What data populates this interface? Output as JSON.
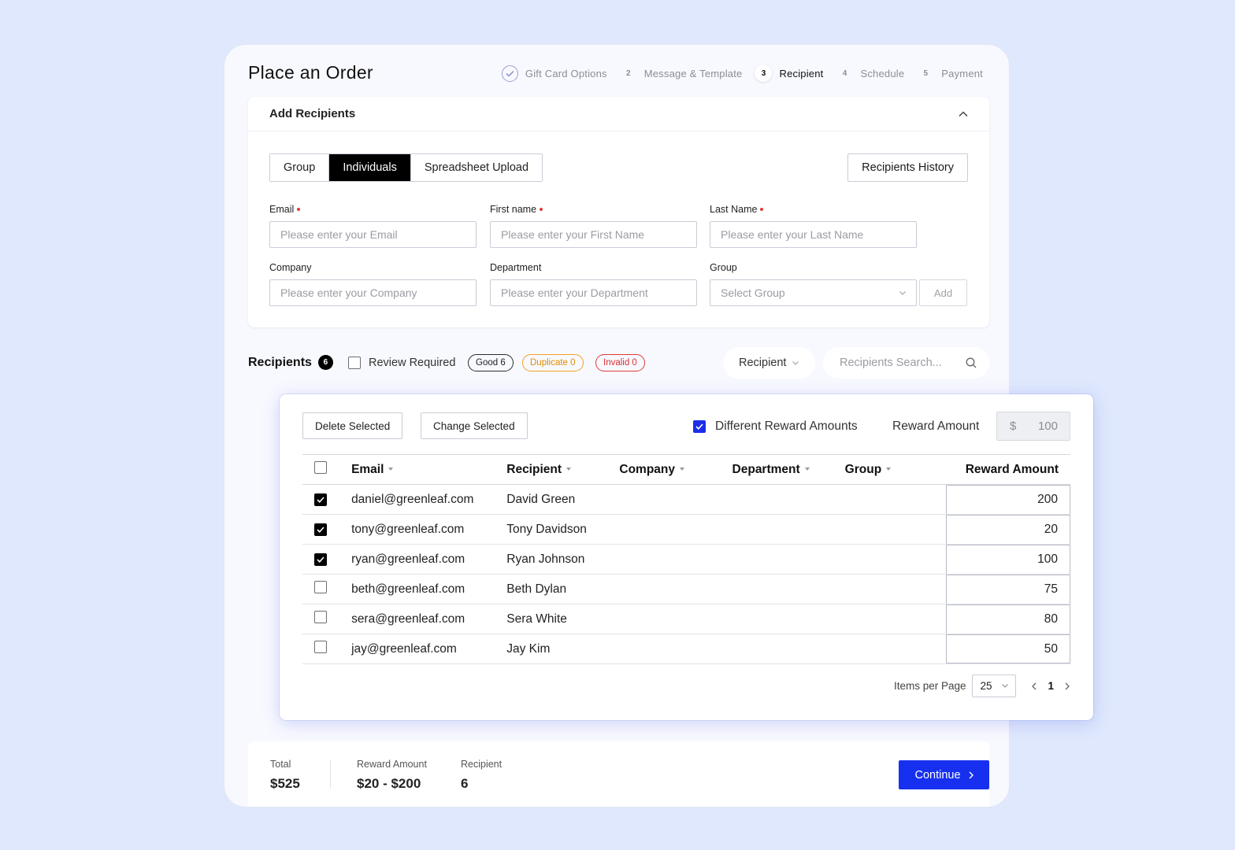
{
  "header": {
    "title": "Place an Order",
    "steps": [
      {
        "num": "",
        "label": "Gift Card Options",
        "state": "done"
      },
      {
        "num": "2",
        "label": "Message & Template",
        "state": "todo"
      },
      {
        "num": "3",
        "label": "Recipient",
        "state": "active"
      },
      {
        "num": "4",
        "label": "Schedule",
        "state": "todo"
      },
      {
        "num": "5",
        "label": "Payment",
        "state": "todo"
      }
    ]
  },
  "add_panel": {
    "title": "Add Recipients",
    "tabs": [
      "Group",
      "Individuals",
      "Spreadsheet Upload"
    ],
    "active_tab": "Individuals",
    "history_label": "Recipients History",
    "fields": {
      "email": {
        "label": "Email",
        "placeholder": "Please enter your Email"
      },
      "first_name": {
        "label": "First name",
        "placeholder": "Please enter your First Name"
      },
      "last_name": {
        "label": "Last Name",
        "placeholder": "Please enter your Last Name"
      },
      "company": {
        "label": "Company",
        "placeholder": "Please enter your Company"
      },
      "department": {
        "label": "Department",
        "placeholder": "Please enter your Department"
      },
      "group": {
        "label": "Group",
        "placeholder": "Select Group"
      }
    },
    "add_label": "Add"
  },
  "recipients_bar": {
    "title": "Recipients",
    "count": "6",
    "review_label": "Review Required",
    "good": "Good 6",
    "duplicate": "Duplicate 0",
    "invalid": "Invalid 0",
    "filter_label": "Recipient",
    "search_placeholder": "Recipients Search..."
  },
  "table_panel": {
    "delete_label": "Delete Selected",
    "change_label": "Change Selected",
    "different_label": "Different Reward Amounts",
    "reward_label": "Reward Amount",
    "currency": "$",
    "reward_value": "100",
    "columns": [
      "Email",
      "Recipient",
      "Company",
      "Department",
      "Group",
      "Reward Amount"
    ],
    "rows": [
      {
        "email": "daniel@greenleaf.com",
        "recipient": "David Green",
        "company": "",
        "department": "",
        "group": "",
        "amount": "200",
        "checked": true
      },
      {
        "email": "tony@greenleaf.com",
        "recipient": "Tony Davidson",
        "company": "",
        "department": "",
        "group": "",
        "amount": "20",
        "checked": true
      },
      {
        "email": "ryan@greenleaf.com",
        "recipient": "Ryan Johnson",
        "company": "",
        "department": "",
        "group": "",
        "amount": "100",
        "checked": true
      },
      {
        "email": "beth@greenleaf.com",
        "recipient": "Beth Dylan",
        "company": "",
        "department": "",
        "group": "",
        "amount": "75",
        "checked": false
      },
      {
        "email": "sera@greenleaf.com",
        "recipient": "Sera White",
        "company": "",
        "department": "",
        "group": "",
        "amount": "80",
        "checked": false
      },
      {
        "email": "jay@greenleaf.com",
        "recipient": "Jay Kim",
        "company": "",
        "department": "",
        "group": "",
        "amount": "50",
        "checked": false
      }
    ],
    "items_per_page_label": "Items per Page",
    "items_per_page": "25",
    "page": "1"
  },
  "summary": {
    "total_label": "Total",
    "total_value": "$525",
    "reward_label": "Reward Amount",
    "reward_value": "$20 - $200",
    "recipient_label": "Recipient",
    "recipient_value": "6",
    "continue_label": "Continue"
  },
  "colors": {
    "accent": "#1730f0",
    "background": "#dfe8fd",
    "duplicate": "#f0a020",
    "invalid": "#e03a3a"
  }
}
